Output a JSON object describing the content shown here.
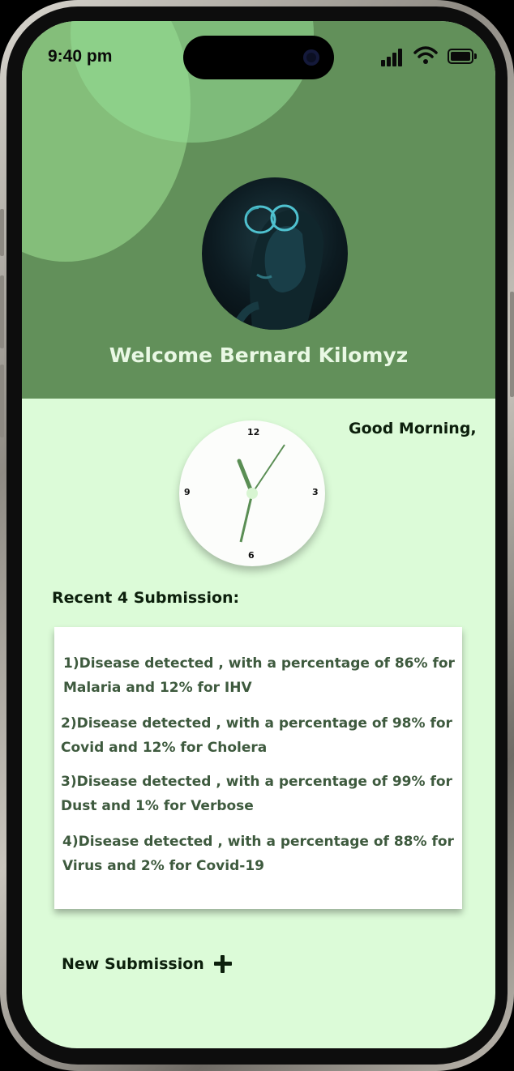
{
  "status_bar": {
    "time": "9:40 pm"
  },
  "header": {
    "welcome_text": "Welcome  Bernard Kilomyz"
  },
  "greeting": "Good  Morning,",
  "clock": {
    "numbers": [
      "12",
      "3",
      "6",
      "9"
    ]
  },
  "recent": {
    "title": "Recent  4 Submission:",
    "items": [
      "1)Disease detected , with a percentage of 86% for Malaria and 12% for IHV",
      "2)Disease detected , with a percentage of 98% for Covid and 12% for Cholera",
      "3)Disease detected , with a percentage of 99% for Dust and 1% for Verbose",
      "4)Disease detected , with a percentage of 88% for Virus and 2% for Covid-19"
    ]
  },
  "new_submission": {
    "label": "New Submission",
    "icon": "plus-icon"
  },
  "colors": {
    "header": "#62905a",
    "body": "#dcfbd8",
    "accent": "#5a8e54"
  }
}
